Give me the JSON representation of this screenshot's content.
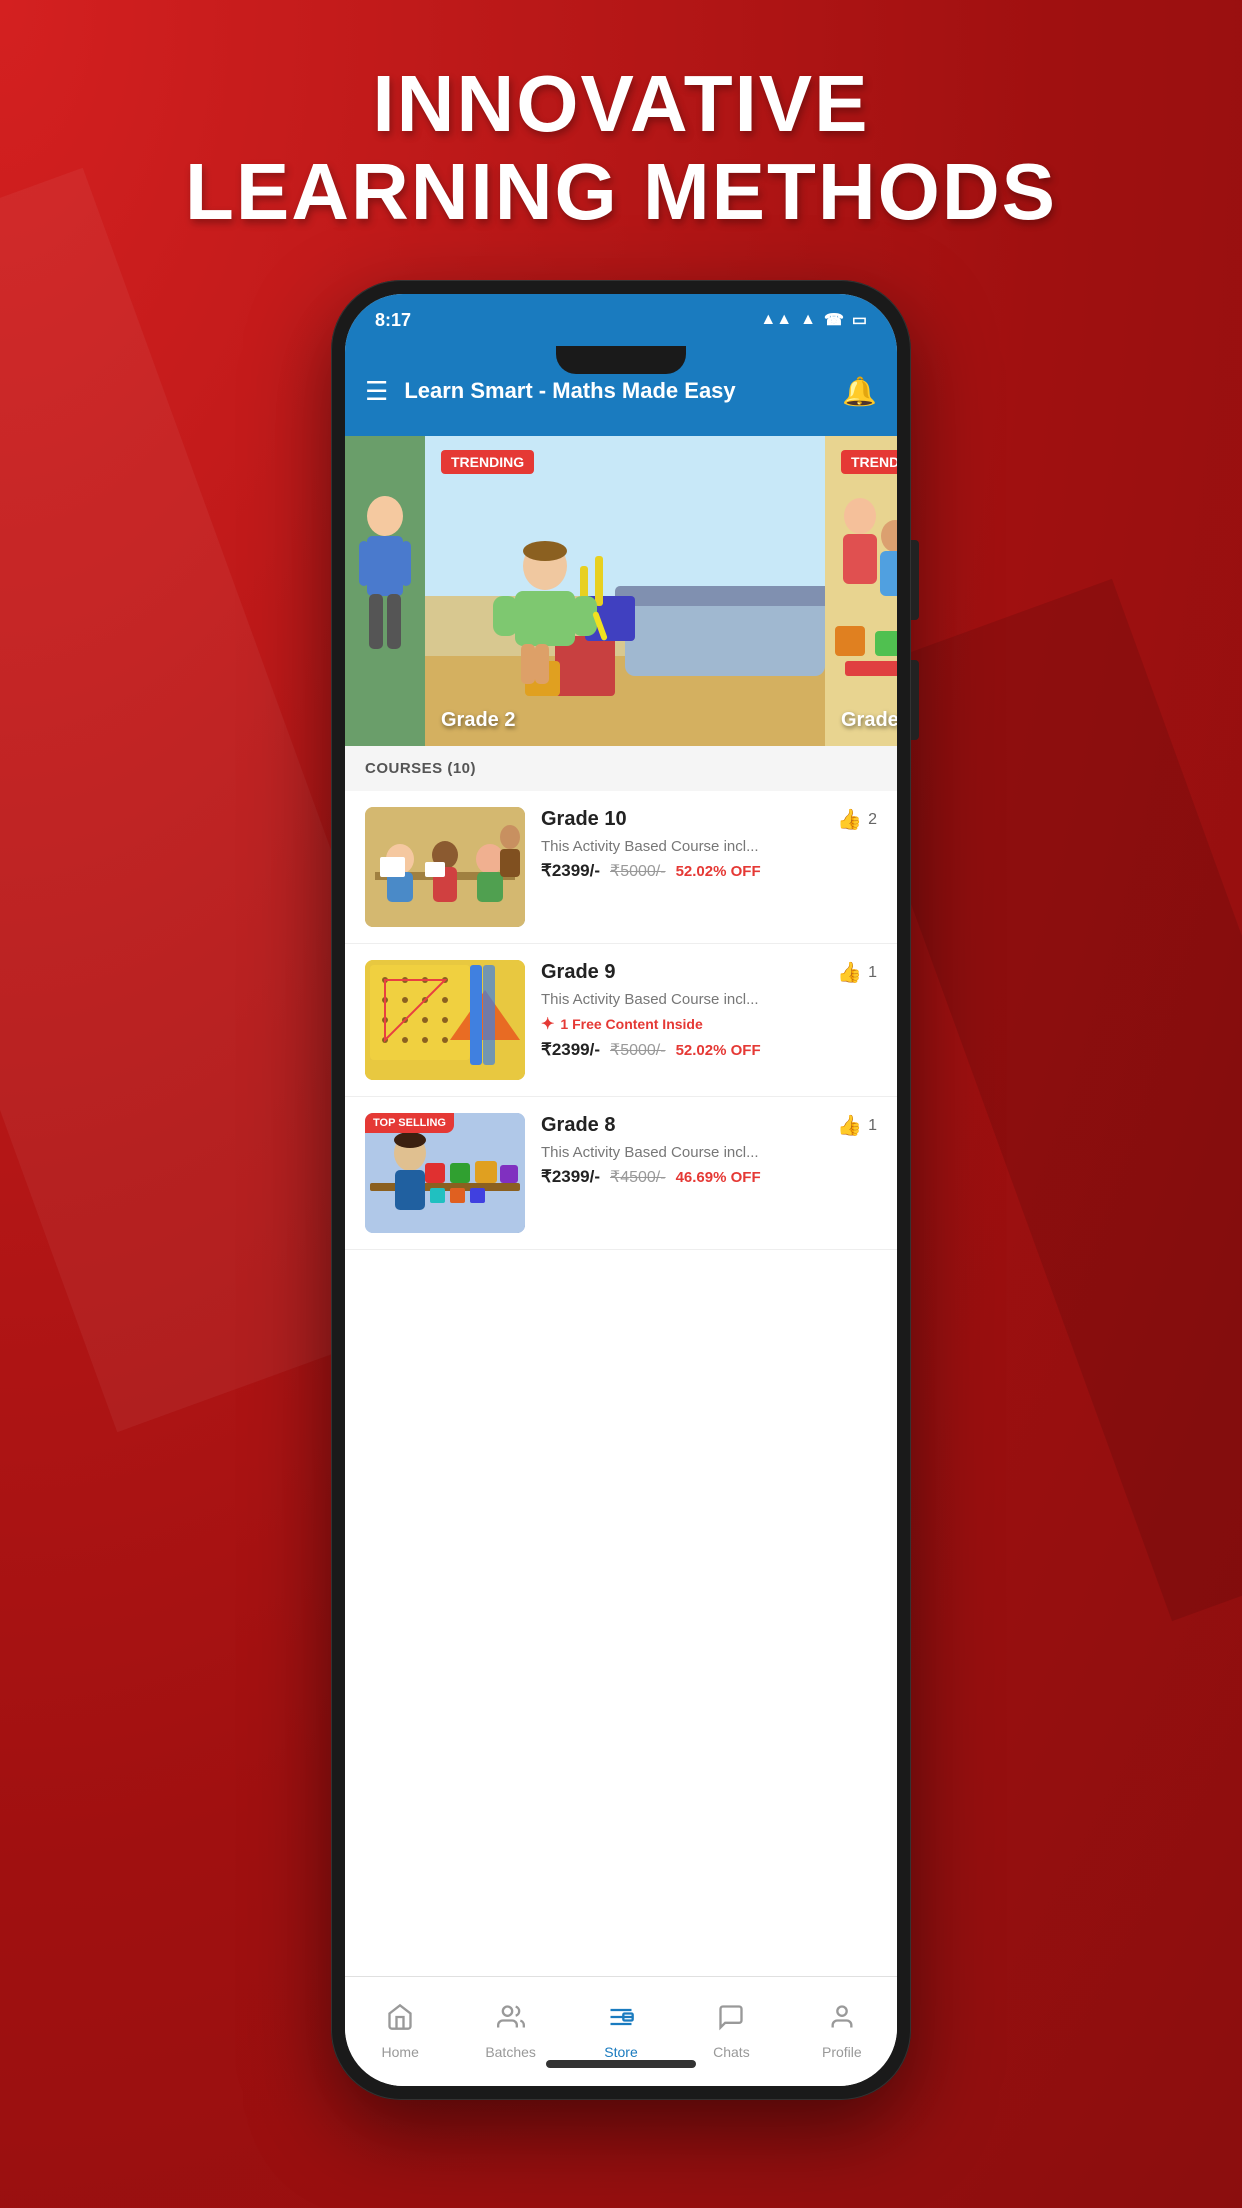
{
  "background": {
    "hero_text_line1": "INNOVATIVE",
    "hero_text_line2": "LEARNING METHODS"
  },
  "app": {
    "title": "Learn Smart - Maths Made Easy",
    "status_time": "8:17",
    "status_icons": "▲▲ ▲ ☎"
  },
  "banners": [
    {
      "id": 1,
      "grade": "",
      "badge": "",
      "bg_class": "banner-bg-1"
    },
    {
      "id": 2,
      "grade": "Grade 2",
      "badge": "TRENDING",
      "bg_class": "banner-bg-2"
    },
    {
      "id": 3,
      "grade": "Grade",
      "badge": "TRENDING",
      "bg_class": "banner-bg-3"
    }
  ],
  "courses_header": "COURSES (10)",
  "courses": [
    {
      "id": 1,
      "title": "Grade 10",
      "description": "This Activity Based Course incl...",
      "likes": 2,
      "price_current": "₹2399/-",
      "price_original": "₹5000/-",
      "discount": "52.02% OFF",
      "free_content": null,
      "badge": null,
      "bg_class": "course-thumb-bg-1"
    },
    {
      "id": 2,
      "title": "Grade 9",
      "description": "This Activity Based Course incl...",
      "likes": 1,
      "price_current": "₹2399/-",
      "price_original": "₹5000/-",
      "discount": "52.02% OFF",
      "free_content": "1 Free Content Inside",
      "badge": null,
      "bg_class": "course-thumb-bg-2"
    },
    {
      "id": 3,
      "title": "Grade 8",
      "description": "This Activity Based Course incl...",
      "likes": 1,
      "price_current": "₹2399/-",
      "price_original": "₹4500/-",
      "discount": "46.69% OFF",
      "free_content": null,
      "badge": "TOP SELLING",
      "bg_class": "course-thumb-bg-3"
    }
  ],
  "nav": {
    "items": [
      {
        "label": "Home",
        "icon": "⌂",
        "active": false
      },
      {
        "label": "Batches",
        "icon": "👤",
        "active": false
      },
      {
        "label": "Store",
        "icon": "☰",
        "active": true
      },
      {
        "label": "Chats",
        "icon": "💬",
        "active": false
      },
      {
        "label": "Profile",
        "icon": "◯",
        "active": false
      }
    ]
  }
}
